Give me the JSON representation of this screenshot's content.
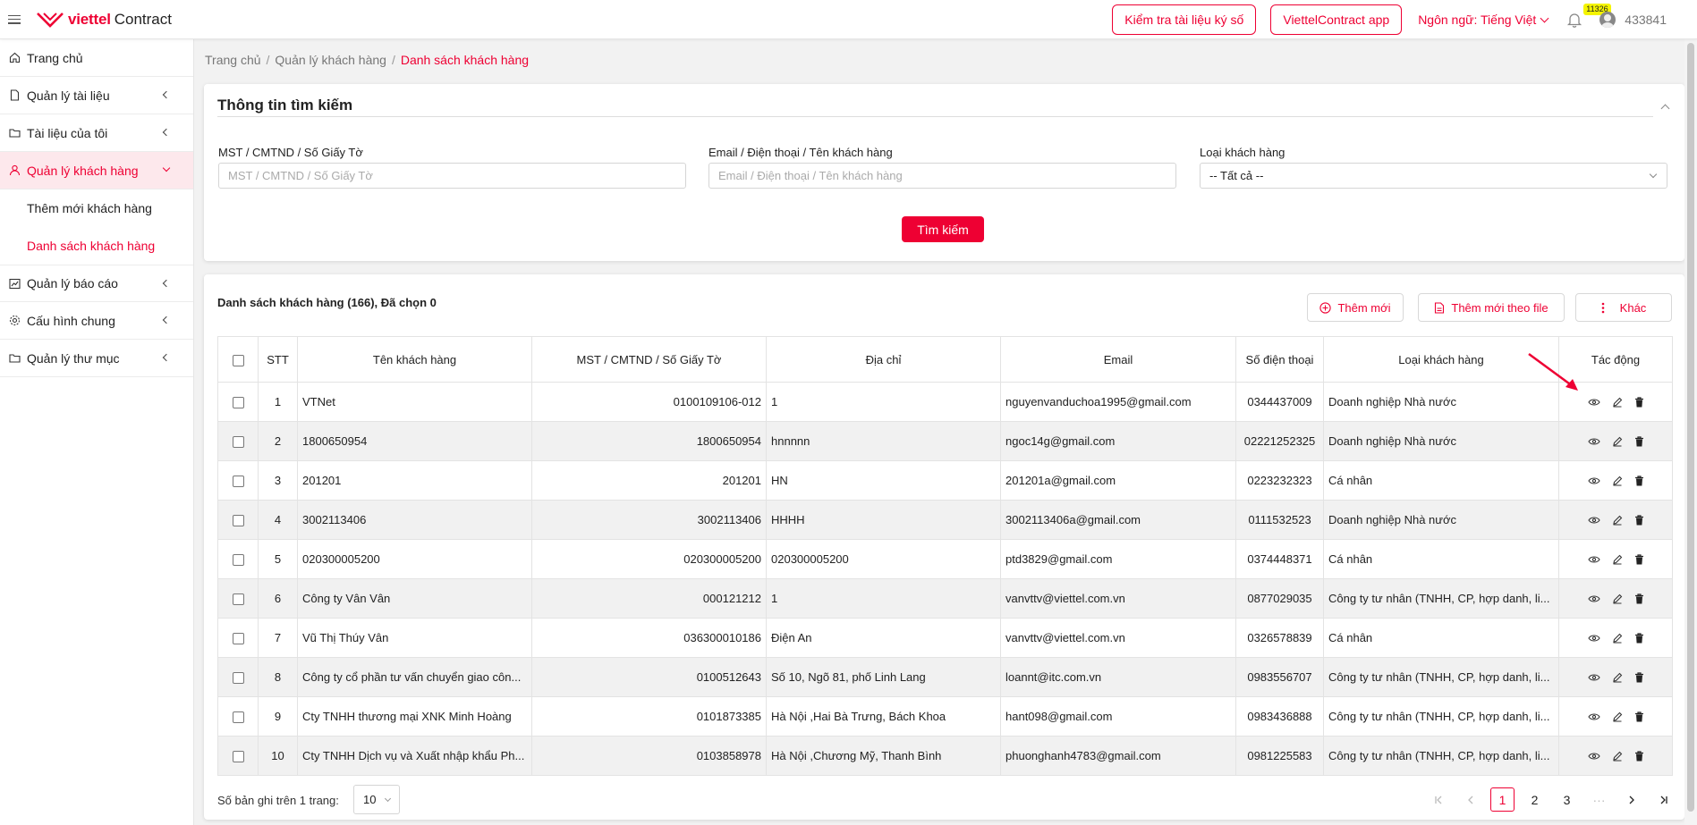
{
  "header": {
    "brand": "viettel",
    "product": "Contract",
    "check_btn": "Kiểm tra tài liệu ký số",
    "app_btn": "ViettelContract app",
    "language": "Ngôn ngữ: Tiếng Việt",
    "notifications": "11326",
    "username": "433841"
  },
  "sidebar": {
    "items": [
      {
        "label": "Trang chủ",
        "icon": "home-icon"
      },
      {
        "label": "Quản lý tài liệu",
        "icon": "file-icon"
      },
      {
        "label": "Tài liệu của tôi",
        "icon": "folder-icon"
      },
      {
        "label": "Quản lý khách hàng",
        "icon": "user-icon"
      },
      {
        "label": "Quản lý báo cáo",
        "icon": "chart-icon"
      },
      {
        "label": "Cấu hình chung",
        "icon": "gear-icon"
      },
      {
        "label": "Quản lý thư mục",
        "icon": "folder-icon"
      }
    ],
    "subitems": [
      "Thêm mới khách hàng",
      "Danh sách khách hàng"
    ]
  },
  "breadcrumb": [
    "Trang chủ",
    "Quản lý khách hàng",
    "Danh sách khách hàng"
  ],
  "search": {
    "title": "Thông tin tìm kiếm",
    "field1_label": "MST / CMTND / Số Giấy Tờ",
    "field1_placeholder": "MST / CMTND / Số Giấy Tờ",
    "field2_label": "Email / Điện thoại / Tên khách hàng",
    "field2_placeholder": "Email / Điện thoại / Tên khách hàng",
    "field3_label": "Loại khách hàng",
    "field3_value": "-- Tất cả --",
    "button": "Tìm kiếm"
  },
  "list": {
    "title": "Danh sách khách hàng (166), Đã chọn 0",
    "add_btn": "Thêm mới",
    "add_file_btn": "Thêm mới theo file",
    "more_btn": "Khác",
    "columns": [
      "STT",
      "Tên khách hàng",
      "MST / CMTND / Số Giấy Tờ",
      "Địa chỉ",
      "Email",
      "Số điện thoại",
      "Loại khách hàng",
      "Tác động"
    ],
    "rows": [
      [
        "1",
        "VTNet",
        "0100109106-012",
        "1",
        "nguyenvanduchoa1995@gmail.com",
        "0344437009",
        "Doanh nghiệp Nhà nước"
      ],
      [
        "2",
        "1800650954",
        "1800650954",
        "hnnnnn",
        "ngoc14g@gmail.com",
        "02221252325",
        "Doanh nghiệp Nhà nước"
      ],
      [
        "3",
        "201201",
        "201201",
        "HN",
        "201201a@gmail.com",
        "0223232323",
        "Cá nhân"
      ],
      [
        "4",
        "3002113406",
        "3002113406",
        "HHHH",
        "3002113406a@gmail.com",
        "0111532523",
        "Doanh nghiệp Nhà nước"
      ],
      [
        "5",
        "020300005200",
        "020300005200",
        "020300005200",
        "ptd3829@gmail.com",
        "0374448371",
        "Cá nhân"
      ],
      [
        "6",
        "Công ty Vân Vân",
        "000121212",
        "1",
        "vanvttv@viettel.com.vn",
        "0877029035",
        "Công ty tư nhân (TNHH, CP, hợp danh, li..."
      ],
      [
        "7",
        "Vũ Thị Thúy Vân",
        "036300010186",
        "Điện An",
        "vanvttv@viettel.com.vn",
        "0326578839",
        "Cá nhân"
      ],
      [
        "8",
        "Công ty cổ phần tư vấn chuyển giao côn...",
        "0100512643",
        "Số 10, Ngõ 81, phố Linh Lang",
        "loannt@itc.com.vn",
        "0983556707",
        "Công ty tư nhân (TNHH, CP, hợp danh, li..."
      ],
      [
        "9",
        "Cty TNHH thương mại XNK Minh Hoàng",
        "0101873385",
        "Hà Nội ,Hai Bà Trưng, Bách Khoa",
        "hant098@gmail.com",
        "0983436888",
        "Công ty tư nhân (TNHH, CP, hợp danh, li..."
      ],
      [
        "10",
        "Cty TNHH Dịch vụ và Xuất nhập khẩu Ph...",
        "0103858978",
        "Hà Nội ,Chương Mỹ, Thanh Bình",
        "phuonghanh4783@gmail.com",
        "0981225583",
        "Công ty tư nhân (TNHH, CP, hợp danh, li..."
      ]
    ]
  },
  "pager": {
    "label": "Số bản ghi trên 1 trang:",
    "page_size": "10",
    "pages": [
      "1",
      "2",
      "3"
    ],
    "ellipsis": "···",
    "current": "1"
  },
  "colors": {
    "accent": "#ee0033",
    "badge": "#f4f400"
  }
}
